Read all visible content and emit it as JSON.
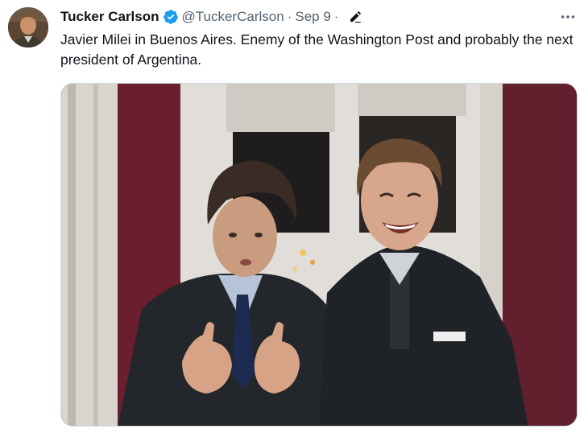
{
  "tweet": {
    "author": {
      "display_name": "Tucker Carlson",
      "handle": "@TuckerCarlson",
      "verified": true,
      "avatar_icon": "avatar-image"
    },
    "separator": "·",
    "date": "Sep 9",
    "date_separator": "·",
    "edit_icon": "pencil-icon",
    "more_icon": "ellipsis-icon",
    "text": "Javier Milei in Buenos Aires. Enemy of the Washington Post and probably the next president of Argentina.",
    "media": {
      "type": "photo"
    }
  },
  "colors": {
    "verified": "#1d9bf0",
    "secondary_text": "#536471",
    "primary_text": "#0f1419",
    "wall": "#6b1e2e",
    "suit": "#1f2124"
  }
}
